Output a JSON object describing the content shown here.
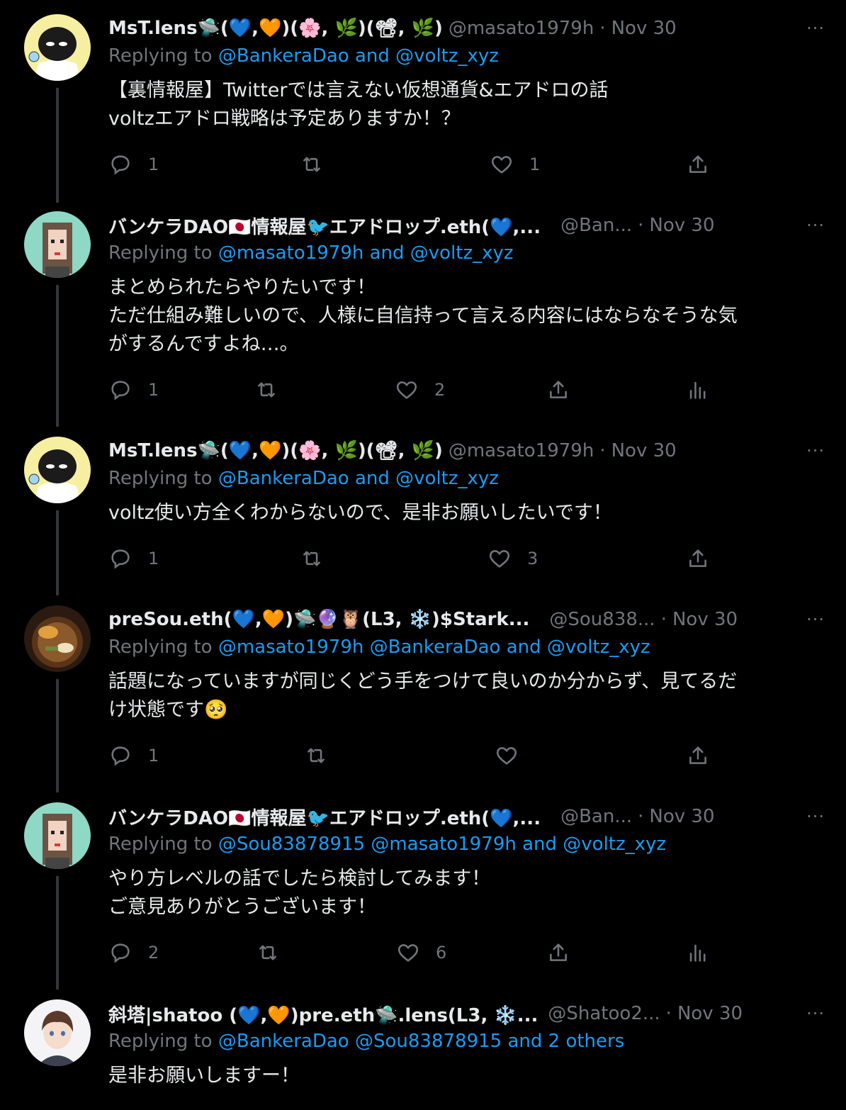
{
  "tweets": [
    {
      "name": "MsT.lens🛸(💙,🧡)(🌸, 🌿)(📽, 🌿)",
      "handle": "@masato1979h",
      "sep": "·",
      "time": "Nov 30",
      "more": "···",
      "replying_prefix": "Replying to",
      "replying_to": "@BankeraDao and @voltz_xyz",
      "lines": [
        "【裏情報屋】Twitterでは言えない仮想通貨&エアドロの話",
        "voltzエアドロ戦略は予定ありますか！？"
      ],
      "reply_count": "1",
      "retweet_count": "",
      "like_count": "1",
      "avatar": "black-bird-cartoon"
    },
    {
      "name": "バンケラDAO🇯🇵情報屋🐦エアドロップ.eth(💙,...",
      "handle": "@Ban...",
      "sep": "·",
      "time": "Nov 30",
      "more": "···",
      "replying_prefix": "Replying to",
      "replying_to": "@masato1979h and @voltz_xyz",
      "lines": [
        "まとめられたらやりたいです！",
        "ただ仕組み難しいので、人様に自信持って言える内容にはならなそうな気",
        "がするんですよね…。"
      ],
      "reply_count": "1",
      "retweet_count": "",
      "like_count": "2",
      "avatar": "pixel-girl"
    },
    {
      "name": "MsT.lens🛸(💙,🧡)(🌸, 🌿)(📽, 🌿)",
      "handle": "@masato1979h",
      "sep": "·",
      "time": "Nov 30",
      "more": "···",
      "replying_prefix": "Replying to",
      "replying_to": "@BankeraDao and @voltz_xyz",
      "lines": [
        "voltz使い方全くわからないので、是非お願いしたいです！"
      ],
      "reply_count": "1",
      "retweet_count": "",
      "like_count": "3",
      "avatar": "black-bird-cartoon"
    },
    {
      "name": "preSou.eth(💙,🧡)🛸🔮🦉(L3, ❄️)$Stark...",
      "handle": "@Sou838...",
      "sep": "·",
      "time": "Nov 30",
      "more": "···",
      "replying_prefix": "Replying to",
      "replying_to": "@masato1979h @BankeraDao and @voltz_xyz",
      "lines": [
        "話題になっていますが同じくどう手をつけて良いのか分からず、見てるだ",
        "け状態です🥺"
      ],
      "reply_count": "1",
      "retweet_count": "",
      "like_count": "",
      "avatar": "tempura-soba"
    },
    {
      "name": "バンケラDAO🇯🇵情報屋🐦エアドロップ.eth(💙,...",
      "handle": "@Ban...",
      "sep": "·",
      "time": "Nov 30",
      "more": "···",
      "replying_prefix": "Replying to",
      "replying_to": "@Sou83878915 @masato1979h and @voltz_xyz",
      "lines": [
        "やり方レベルの話でしたら検討してみます！",
        "ご意見ありがとうございます！"
      ],
      "reply_count": "2",
      "retweet_count": "",
      "like_count": "6",
      "avatar": "pixel-girl"
    },
    {
      "name": "斜塔|shatoo (💙,🧡)pre.eth🛸.lens(L3, ❄️...",
      "handle": "@Shatoo2...",
      "sep": "·",
      "time": "Nov 30",
      "more": "···",
      "replying_prefix": "Replying to",
      "replying_to": "@BankeraDao @Sou83878915 and 2 others",
      "lines": [
        "是非お願いしますー！"
      ],
      "reply_count": "",
      "retweet_count": "",
      "like_count": "",
      "avatar": "anime-boy"
    }
  ],
  "colors": {
    "background": "#000000",
    "text": "#e7e9ea",
    "muted": "#71767b",
    "link": "#1d9bf0",
    "thread": "#333639"
  }
}
